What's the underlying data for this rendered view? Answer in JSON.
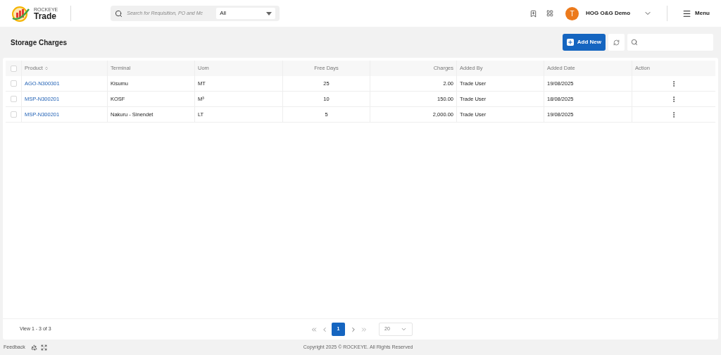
{
  "header": {
    "brand_top": "ROCKEYE",
    "brand": "Trade",
    "search": {
      "placeholder": "Search for Requisition, PO and Mc"
    },
    "filter": "All",
    "user_initial": "T",
    "user_name": "HOG O&G Demo",
    "menu": "Menu"
  },
  "page": {
    "title": "Storage Charges",
    "add_button": "Add New"
  },
  "table": {
    "columns": [
      {
        "label": "Product",
        "sortable": true
      },
      {
        "label": "Terminal",
        "sortable": false
      },
      {
        "label": "Uom",
        "sortable": false
      },
      {
        "label": "Free Days",
        "sortable": false
      },
      {
        "label": "Charges",
        "sortable": false
      },
      {
        "label": "Added By",
        "sortable": false
      },
      {
        "label": "Added Date",
        "sortable": false
      },
      {
        "label": "Action",
        "sortable": false
      }
    ],
    "all_checked": false,
    "rows": [
      {
        "checked": false,
        "cells": [
          "AGO-N300301",
          "Kisumu",
          "MT",
          "25",
          "2.00",
          "Trade User",
          "19/08/2025"
        ]
      },
      {
        "checked": false,
        "cells": [
          "MSP-N300201",
          "KOSF",
          "M³",
          "10",
          "150.00",
          "Trade User",
          "18/08/2025"
        ]
      },
      {
        "checked": false,
        "cells": [
          "MSP-N300201",
          "Nakuru - Sinendet",
          "LT",
          "5",
          "2,000.00",
          "Trade User",
          "19/08/2025"
        ]
      }
    ]
  },
  "pagination": {
    "summary": "View 1 - 3 of 3",
    "pages": [
      {
        "label": "1",
        "selected": true
      }
    ],
    "page_size": "20"
  },
  "footer": {
    "feedback": "Feedback",
    "copyright": "Copyright 2025 © ROCKEYE. All Rights Reserved"
  }
}
